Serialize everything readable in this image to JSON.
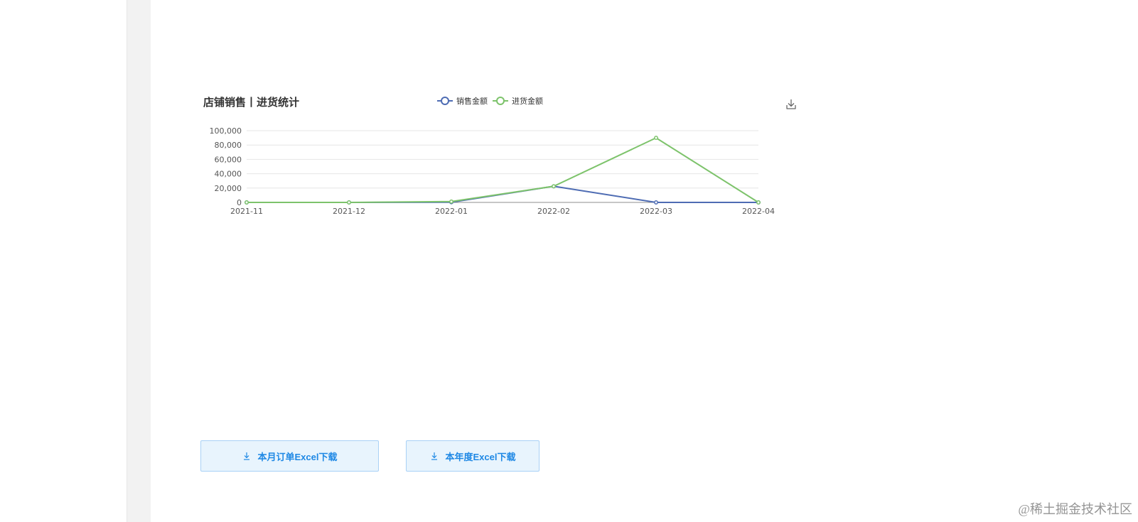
{
  "chart_data": {
    "type": "line",
    "title": "店铺销售丨进货统计",
    "categories": [
      "2021-11",
      "2021-12",
      "2022-01",
      "2022-02",
      "2022-03",
      "2022-04"
    ],
    "series": [
      {
        "name": "销售金额",
        "values": [
          0,
          0,
          300,
          22500,
          0,
          0
        ],
        "color": "#4e6cb3"
      },
      {
        "name": "进货金额",
        "values": [
          0,
          0,
          1200,
          22500,
          90000,
          0
        ],
        "color": "#7dc36b"
      }
    ],
    "y_ticks": [
      "100,000",
      "80,000",
      "60,000",
      "40,000",
      "20,000",
      "0"
    ],
    "ylim": [
      0,
      100000
    ],
    "legend": "top-center",
    "grid": true,
    "download_icon": "download-icon"
  },
  "buttons": {
    "month_excel_label": "本月订单Excel下载",
    "year_excel_label": "本年度Excel下载",
    "icon": "download-icon"
  },
  "watermark": "@稀土掘金技术社区"
}
